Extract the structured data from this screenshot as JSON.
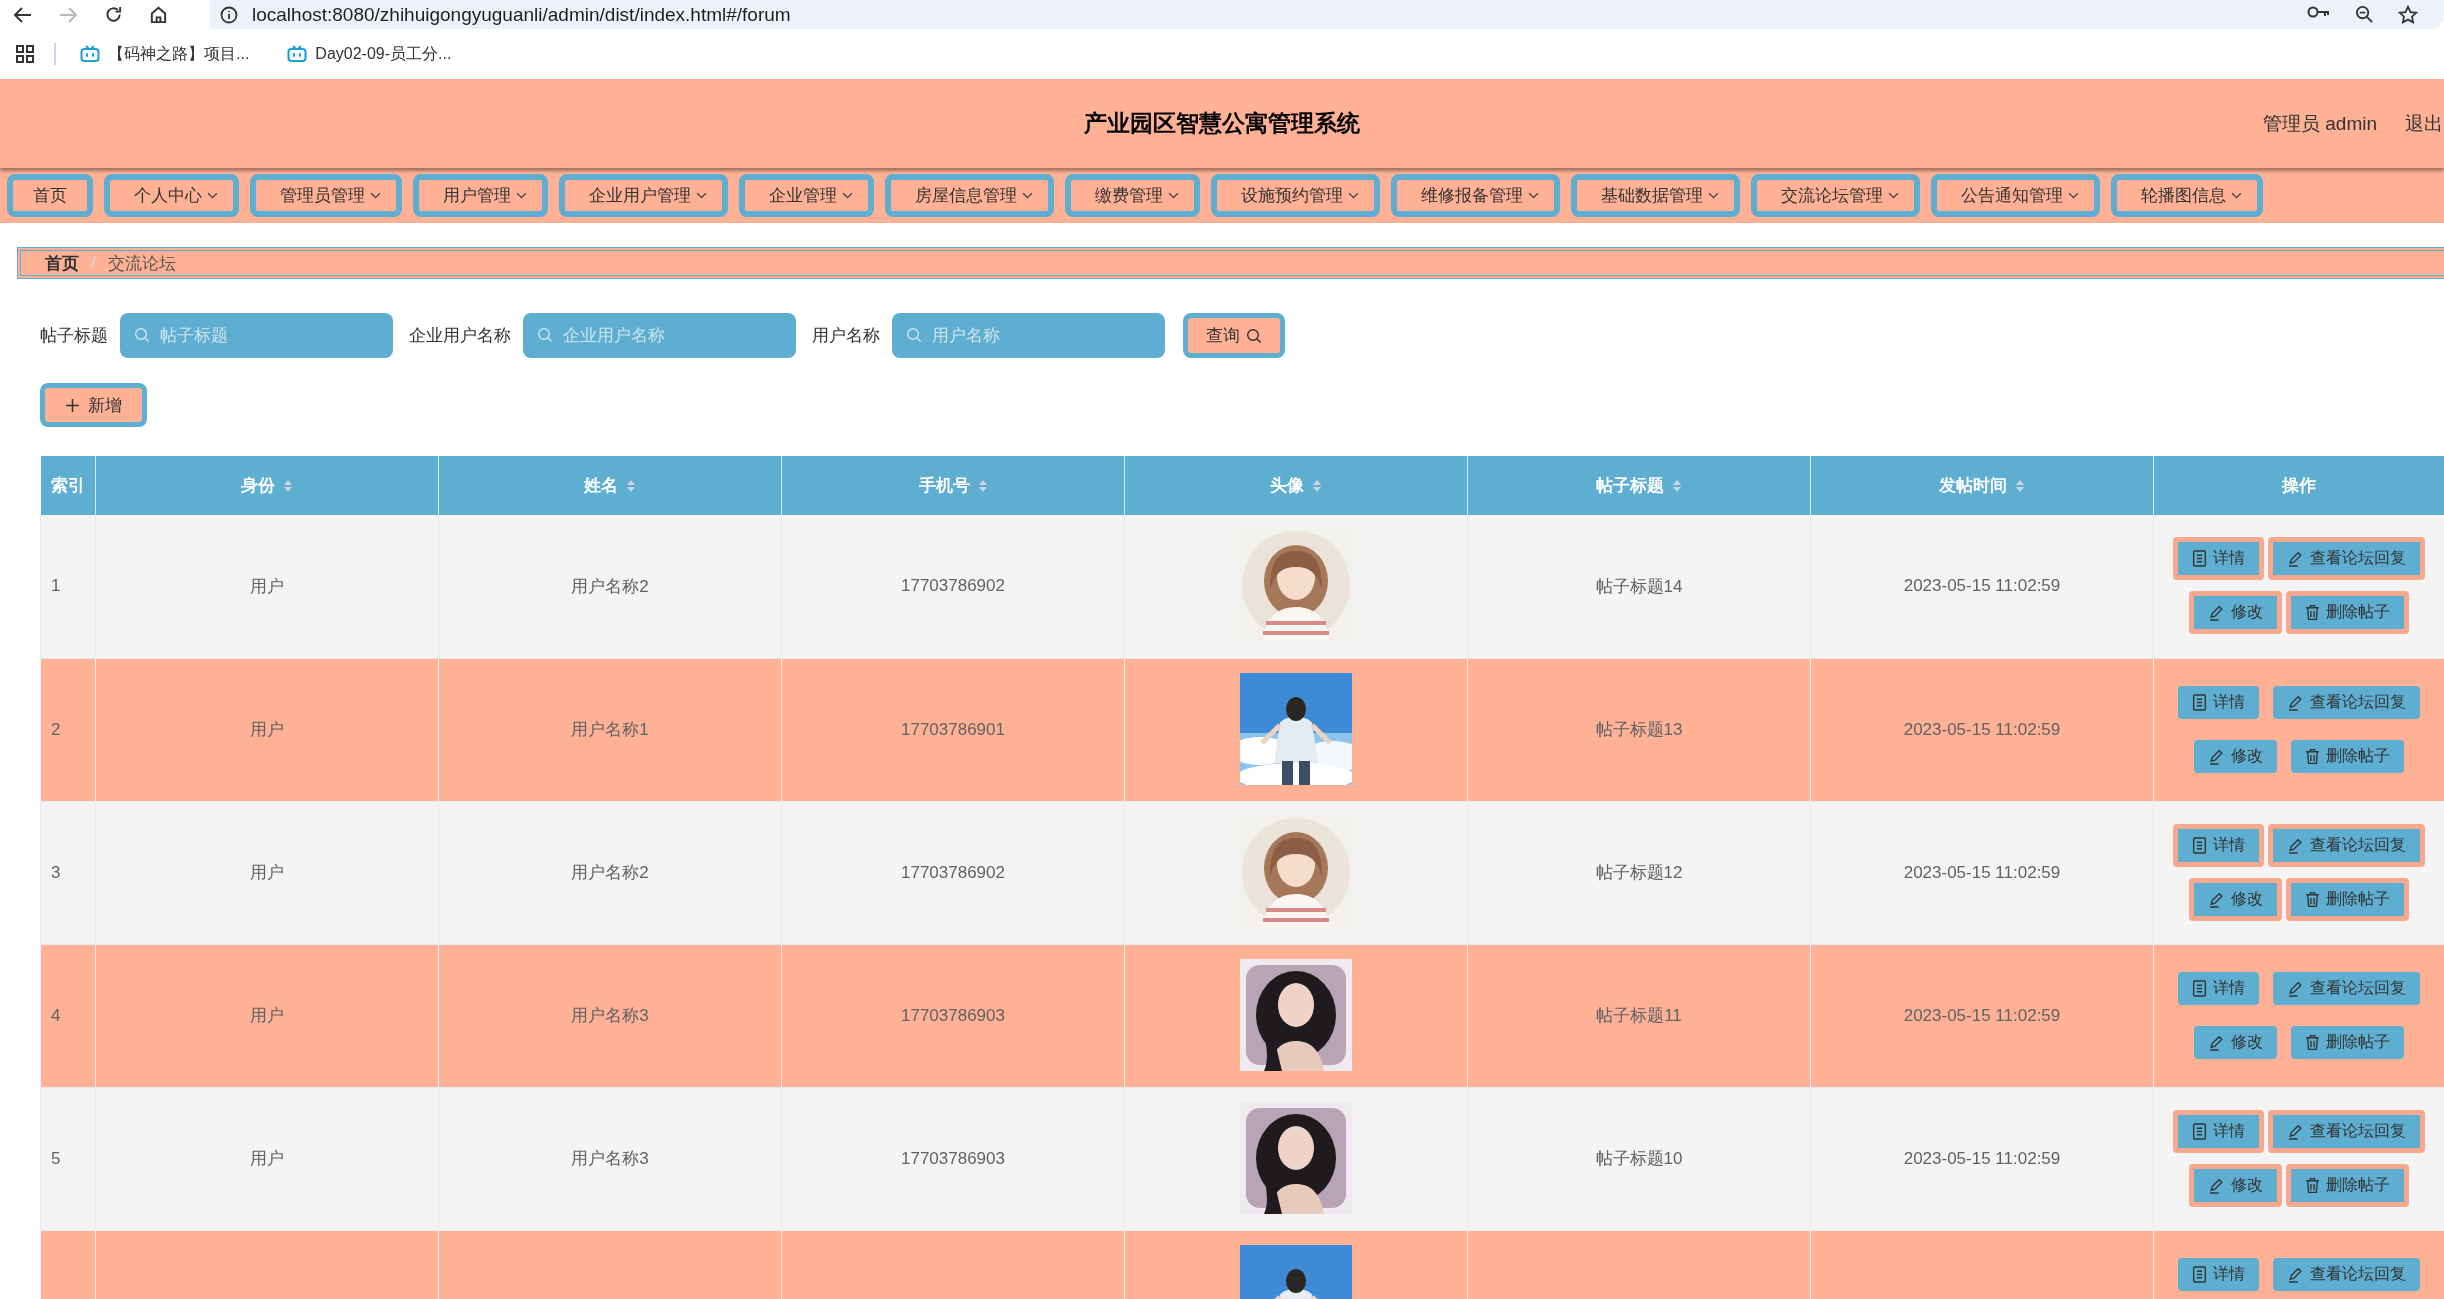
{
  "browser": {
    "url": "localhost:8080/zhihuigongyuguanli/admin/dist/index.html#/forum",
    "forward_disabled": true,
    "bookmarks": [
      {
        "label": "【码神之路】项目..."
      },
      {
        "label": "Day02-09-员工分..."
      }
    ]
  },
  "header": {
    "title": "产业园区智慧公寓管理系统",
    "user": "管理员 admin",
    "logout": "退出"
  },
  "nav": [
    {
      "label": "首页",
      "dropdown": false
    },
    {
      "label": "个人中心",
      "dropdown": true
    },
    {
      "label": "管理员管理",
      "dropdown": true
    },
    {
      "label": "用户管理",
      "dropdown": true
    },
    {
      "label": "企业用户管理",
      "dropdown": true
    },
    {
      "label": "企业管理",
      "dropdown": true
    },
    {
      "label": "房屋信息管理",
      "dropdown": true
    },
    {
      "label": "缴费管理",
      "dropdown": true
    },
    {
      "label": "设施预约管理",
      "dropdown": true
    },
    {
      "label": "维修报备管理",
      "dropdown": true
    },
    {
      "label": "基础数据管理",
      "dropdown": true
    },
    {
      "label": "交流论坛管理",
      "dropdown": true
    },
    {
      "label": "公告通知管理",
      "dropdown": true
    },
    {
      "label": "轮播图信息",
      "dropdown": true
    }
  ],
  "breadcrumb": {
    "separator": "/",
    "items": [
      {
        "label": "首页"
      },
      {
        "label": "交流论坛"
      }
    ]
  },
  "search": {
    "fields": [
      {
        "label": "帖子标题",
        "placeholder": "帖子标题"
      },
      {
        "label": "企业用户名称",
        "placeholder": "企业用户名称"
      },
      {
        "label": "用户名称",
        "placeholder": "用户名称"
      }
    ],
    "button": "查询"
  },
  "add_button": "新增",
  "table": {
    "columns": [
      {
        "label": "索引",
        "sortable": false
      },
      {
        "label": "身份",
        "sortable": true
      },
      {
        "label": "姓名",
        "sortable": true
      },
      {
        "label": "手机号",
        "sortable": true
      },
      {
        "label": "头像",
        "sortable": true
      },
      {
        "label": "帖子标题",
        "sortable": true
      },
      {
        "label": "发帖时间",
        "sortable": true
      },
      {
        "label": "操作",
        "sortable": false
      }
    ],
    "rows": [
      {
        "index": "1",
        "role": "用户",
        "name": "用户名称2",
        "phone": "17703786902",
        "avatar": {
          "kind": "picture"
        },
        "title": "帖子标题14",
        "time": "2023-05-15 11:02:59",
        "ringed": true,
        "actions": [
          {
            "kind": "detail",
            "label": "详情"
          },
          {
            "kind": "replies",
            "label": "查看论坛回复"
          },
          {
            "kind": "edit",
            "label": "修改"
          },
          {
            "kind": "delete",
            "label": "删除帖子"
          }
        ]
      },
      {
        "index": "2",
        "role": "用户",
        "name": "用户名称1",
        "phone": "17703786901",
        "avatar": {
          "kind": "picture"
        },
        "title": "帖子标题13",
        "time": "2023-05-15 11:02:59",
        "ringed": false,
        "actions": [
          {
            "kind": "detail",
            "label": "详情"
          },
          {
            "kind": "replies",
            "label": "查看论坛回复"
          },
          {
            "kind": "edit",
            "label": "修改"
          },
          {
            "kind": "delete",
            "label": "删除帖子"
          }
        ]
      },
      {
        "index": "3",
        "role": "用户",
        "name": "用户名称2",
        "phone": "17703786902",
        "avatar": {
          "kind": "picture"
        },
        "title": "帖子标题12",
        "time": "2023-05-15 11:02:59",
        "ringed": true,
        "actions": [
          {
            "kind": "detail",
            "label": "详情"
          },
          {
            "kind": "replies",
            "label": "查看论坛回复"
          },
          {
            "kind": "edit",
            "label": "修改"
          },
          {
            "kind": "delete",
            "label": "删除帖子"
          }
        ]
      },
      {
        "index": "4",
        "role": "用户",
        "name": "用户名称3",
        "phone": "17703786903",
        "avatar": {
          "kind": "picture"
        },
        "title": "帖子标题11",
        "time": "2023-05-15 11:02:59",
        "ringed": false,
        "actions": [
          {
            "kind": "detail",
            "label": "详情"
          },
          {
            "kind": "replies",
            "label": "查看论坛回复"
          },
          {
            "kind": "edit",
            "label": "修改"
          },
          {
            "kind": "delete",
            "label": "删除帖子"
          }
        ]
      },
      {
        "index": "5",
        "role": "用户",
        "name": "用户名称3",
        "phone": "17703786903",
        "avatar": {
          "kind": "picture"
        },
        "title": "帖子标题10",
        "time": "2023-05-15 11:02:59",
        "ringed": true,
        "actions": [
          {
            "kind": "detail",
            "label": "详情"
          },
          {
            "kind": "replies",
            "label": "查看论坛回复"
          },
          {
            "kind": "edit",
            "label": "修改"
          },
          {
            "kind": "delete",
            "label": "删除帖子"
          }
        ]
      },
      {
        "avatar": {
          "kind": "picture"
        },
        "ringed": false,
        "actions": [
          {
            "kind": "detail",
            "label": "详情"
          },
          {
            "kind": "replies",
            "label": "查看论坛回复"
          }
        ]
      }
    ]
  }
}
